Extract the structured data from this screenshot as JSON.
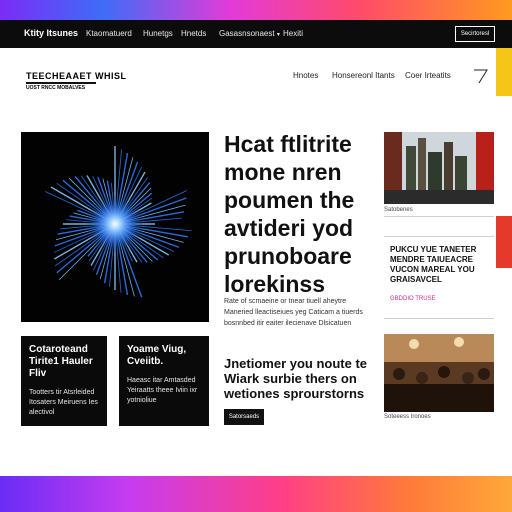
{
  "colors": {
    "nav_bg": "#0c0c0c",
    "accent_yellow": "#f5c518",
    "accent_red": "#e5392b",
    "hero_glow": "#3b8dff",
    "story_meta": "#c0308a"
  },
  "navbar": {
    "brand": "Ktity Itsunes",
    "links": [
      "Ktaomatuerd",
      "Hunetgs",
      "Hnetds",
      "Gasasnsonaest",
      "Hexiti"
    ],
    "cta_label": "Secirtoresl"
  },
  "logo": {
    "name": "TEECHEAAET WHISL",
    "tagline": "UOST RNCC MOBALVES"
  },
  "subnav": {
    "links": [
      "Hnotes",
      "Honsereonl Itants",
      "Coer Irteatits"
    ],
    "icon": "angle-corner-icon"
  },
  "hero": {
    "image_icon": "blue-starburst",
    "headline": "Hcat ftlitrite mone nren poumen the avtideri yod prunoboare lorekinss",
    "body": "Rate of scmaeine or tnear tiuell aheytre Maneried lleactiseiues yeg Caticam a tiuerds bosnnbed itir eaiter ilecienave Dlsicatuen"
  },
  "cards": [
    {
      "title": "Cotaroteand Tirite1 Hauler Fliv",
      "body": "Tootters tir Atsrleided Itosaters Meiruens Ies alectivol"
    },
    {
      "title": "Yoame Viug, Cveiitb.",
      "body": "Haeasc itar Amtasded Yeiraatts theee Iviin ixr yotnioliue"
    }
  ],
  "feature": {
    "title": "Jnetiomer you noute te Wiark surbie thers on wetiones sprourstorns",
    "button_label": "Satorsaeds"
  },
  "sidebar": {
    "story1": {
      "image_icon": "city-skyline-photo",
      "caption": "Satobenes"
    },
    "story2": {
      "title": "PUKCU YUE TANETER MENDRE TAIUEACRE VUCON MAREAL YOU GRAISAVCEL",
      "meta": "GBDDIO TRUSE"
    },
    "story3": {
      "image_icon": "crowd-event-photo",
      "caption": "Soteeess Ironoes"
    }
  }
}
